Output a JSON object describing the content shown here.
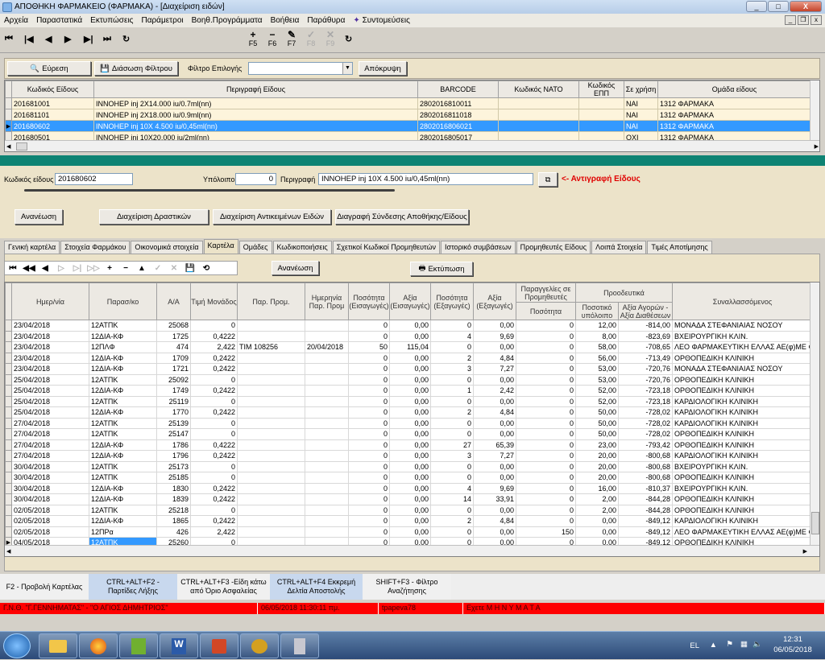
{
  "window": {
    "title": "ΑΠΟΘΗΚΗ ΦΑΡΜΑΚΕΙΟ (ΦΑΡΜΑΚΑ) - [Διαχείριση ειδών]",
    "minimize": "_",
    "maximize": "□",
    "close": "X"
  },
  "menu": [
    "Αρχεία",
    "Παραστατικά",
    "Εκτυπώσεις",
    "Παράμετροι",
    "Βοηθ.Προγράμματα",
    "Βοήθεια",
    "Παράθυρα",
    "Συντομεύσεις"
  ],
  "toolbar": {
    "nav": [
      "⏮",
      "⏭",
      "◀",
      "▶",
      "⏭",
      "▶⏭",
      "↻"
    ],
    "fkeys": [
      {
        "glyph": "+",
        "label": "F5"
      },
      {
        "glyph": "−",
        "label": "F6"
      },
      {
        "glyph": "✎",
        "label": "F7"
      },
      {
        "glyph": "✓",
        "label": "F8"
      },
      {
        "glyph": "✕",
        "label": "F9"
      }
    ],
    "refresh": "↻"
  },
  "filter": {
    "search_label": "Εύρεση",
    "save_filter_label": "Διάσωση Φίλτρου",
    "filter_choice_label": "Φίλτρο Επιλογής",
    "filter_value": "",
    "hide_label": "Απόκρυψη"
  },
  "items_grid": {
    "columns": [
      "Κωδικός Είδους",
      "Περιγραφή Είδους",
      "BARCODE",
      "Κωδικός ΝΑΤΟ",
      "Κωδικός ΕΠΠ",
      "Σε χρήση",
      "Ομάδα είδους"
    ],
    "rows": [
      {
        "code": "201681001",
        "desc": "INNOHEP inj 2X14.000 iu/0.7ml(nn)",
        "barcode": "2802016810011",
        "nato": "",
        "epp": "",
        "in_use": "ΝΑΙ",
        "group": "1312 ΦΑΡΜΑΚΑ"
      },
      {
        "code": "201681101",
        "desc": "INNOHEP inj 2X18.000 iu/0.9ml(nn)",
        "barcode": "2802016811018",
        "nato": "",
        "epp": "",
        "in_use": "ΝΑΙ",
        "group": "1312 ΦΑΡΜΑΚΑ"
      },
      {
        "code": "201680602",
        "desc": "INNOHEP inj 10X 4.500 iu/0,45ml(nn)",
        "barcode": "2802016806021",
        "nato": "",
        "epp": "",
        "in_use": "ΝΑΙ",
        "group": "1312 ΦΑΡΜΑΚΑ"
      },
      {
        "code": "201680501",
        "desc": "INNOHEP inj 10X20.000 iu/2ml(nn)",
        "barcode": "2802016805017",
        "nato": "",
        "epp": "",
        "in_use": "ΟΧΙ",
        "group": "1312 ΦΑΡΜΑΚΑ"
      }
    ],
    "selected_index": 2
  },
  "detail": {
    "code_label": "Κωδικός είδους",
    "code_value": "201680602",
    "balance_label": "Υπόλοιπο",
    "balance_value": "0",
    "desc_label": "Περιγραφή",
    "desc_value": "INNOHEP inj 10X 4.500 iu/0,45ml(nn)",
    "copy_label": "<- Αντιγραφή Είδους",
    "buttons": {
      "refresh": "Ανανέωση",
      "substances": "Διαχείριση Δραστικών",
      "equivalents": "Διαχείριση Αντικειμένων Ειδών",
      "delete_link": "Διαγραφή Σύνδεσης Αποθήκης/Είδους"
    }
  },
  "tabs": [
    "Γενική καρτέλα",
    "Στοιχεία Φαρμάκου",
    "Οικονομικά στοιχεία",
    "Καρτέλα",
    "Ομάδες",
    "Κωδικοποιήσεις",
    "Σχετικοί Κωδικοί Προμηθευτών",
    "Ιστορικό συμβάσεων",
    "Προμηθευτές Είδους",
    "Λοιπά Στοιχεία",
    "Τιμές Αποτίμησης"
  ],
  "active_tab": 3,
  "ledger": {
    "refresh_label": "Ανανέωση",
    "print_label": "Εκτύπωση",
    "nav": [
      "⏮",
      "◀◀",
      "◀",
      "▷",
      "▷|",
      "▷▷",
      "+",
      "−",
      "▲",
      "✓",
      "✕",
      "💾",
      "⟲"
    ],
    "headers": {
      "date": "Ημερ/νία",
      "doc": "Παρασ/κο",
      "aa": "Α/Α",
      "unit_price": "Τιμή Μονάδος",
      "par_prom": "Παρ. Πρoμ.",
      "date_par_prom": "Ημερηνία Παρ. Προμ",
      "qty_in": "Ποσότητα (Εισαγωγές)",
      "val_in": "Αξία (Εισαγωγές)",
      "qty_out": "Ποσότητα (Εξαγωγές)",
      "val_out": "Αξία (Εξαγωγές)",
      "orders": "Παραγγελίες σε Προμηθευτές",
      "orders_qty": "Ποσότητα",
      "progressive": "Προοδευτικά",
      "prog_qty": "Ποσοτικό υπόλοιπο",
      "prog_val": "Αξία Αγορών - Αξία Διαθέσεων",
      "party": "Συναλλασσόμενος"
    },
    "rows": [
      [
        "23/04/2018",
        "12ΑΤΠΚ",
        "25068",
        "0",
        "",
        "",
        "0",
        "0,00",
        "0",
        "0,00",
        "0",
        "12,00",
        "-814,00",
        "ΜΟΝΑΔΑ ΣΤΕΦΑΝΙΑΙΑΣ ΝΟΣΟΥ"
      ],
      [
        "23/04/2018",
        "12ΔΙΑ-ΚΦ",
        "1725",
        "0,4222",
        "",
        "",
        "0",
        "0,00",
        "4",
        "9,69",
        "0",
        "8,00",
        "-823,69",
        "ΒΧΕΙΡΟΥΡΓΙΚΗ ΚΛΙΝ."
      ],
      [
        "23/04/2018",
        "12ΠΛΦ",
        "474",
        "2,422",
        "ΤΙΜ 108256",
        "20/04/2018",
        "50",
        "115,04",
        "0",
        "0,00",
        "0",
        "58,00",
        "-708,65",
        "ΛΕΟ ΦΑΡΜΑΚΕΥΤΙΚΗ ΕΛΛΑΣ ΑΕ(φ)ΜΕ ΦΑ"
      ],
      [
        "23/04/2018",
        "12ΔΙΑ-ΚΦ",
        "1709",
        "0,2422",
        "",
        "",
        "0",
        "0,00",
        "2",
        "4,84",
        "0",
        "56,00",
        "-713,49",
        "ΟΡΘΟΠΕΔΙΚΗ ΚΛΙΝΙΚΗ"
      ],
      [
        "23/04/2018",
        "12ΔΙΑ-ΚΦ",
        "1721",
        "0,2422",
        "",
        "",
        "0",
        "0,00",
        "3",
        "7,27",
        "0",
        "53,00",
        "-720,76",
        "ΜΟΝΑΔΑ ΣΤΕΦΑΝΙΑΙΑΣ ΝΟΣΟΥ"
      ],
      [
        "25/04/2018",
        "12ΑΤΠΚ",
        "25092",
        "0",
        "",
        "",
        "0",
        "0,00",
        "0",
        "0,00",
        "0",
        "53,00",
        "-720,76",
        "ΟΡΘΟΠΕΔΙΚΗ ΚΛΙΝΙΚΗ"
      ],
      [
        "25/04/2018",
        "12ΔΙΑ-ΚΦ",
        "1749",
        "0,2422",
        "",
        "",
        "0",
        "0,00",
        "1",
        "2,42",
        "0",
        "52,00",
        "-723,18",
        "ΟΡΘΟΠΕΔΙΚΗ ΚΛΙΝΙΚΗ"
      ],
      [
        "25/04/2018",
        "12ΑΤΠΚ",
        "25119",
        "0",
        "",
        "",
        "0",
        "0,00",
        "0",
        "0,00",
        "0",
        "52,00",
        "-723,18",
        "ΚΑΡΔΙΟΛΟΓΙΚΗ ΚΛΙΝΙΚΗ"
      ],
      [
        "25/04/2018",
        "12ΔΙΑ-ΚΦ",
        "1770",
        "0,2422",
        "",
        "",
        "0",
        "0,00",
        "2",
        "4,84",
        "0",
        "50,00",
        "-728,02",
        "ΚΑΡΔΙΟΛΟΓΙΚΗ ΚΛΙΝΙΚΗ"
      ],
      [
        "27/04/2018",
        "12ΑΤΠΚ",
        "25139",
        "0",
        "",
        "",
        "0",
        "0,00",
        "0",
        "0,00",
        "0",
        "50,00",
        "-728,02",
        "ΚΑΡΔΙΟΛΟΓΙΚΗ ΚΛΙΝΙΚΗ"
      ],
      [
        "27/04/2018",
        "12ΑΤΠΚ",
        "25147",
        "0",
        "",
        "",
        "0",
        "0,00",
        "0",
        "0,00",
        "0",
        "50,00",
        "-728,02",
        "ΟΡΘΟΠΕΔΙΚΗ ΚΛΙΝΙΚΗ"
      ],
      [
        "27/04/2018",
        "12ΔΙΑ-ΚΦ",
        "1786",
        "0,4222",
        "",
        "",
        "0",
        "0,00",
        "27",
        "65,39",
        "0",
        "23,00",
        "-793,42",
        "ΟΡΘΟΠΕΔΙΚΗ ΚΛΙΝΙΚΗ"
      ],
      [
        "27/04/2018",
        "12ΔΙΑ-ΚΦ",
        "1796",
        "0,2422",
        "",
        "",
        "0",
        "0,00",
        "3",
        "7,27",
        "0",
        "20,00",
        "-800,68",
        "ΚΑΡΔΙΟΛΟΓΙΚΗ ΚΛΙΝΙΚΗ"
      ],
      [
        "30/04/2018",
        "12ΑΤΠΚ",
        "25173",
        "0",
        "",
        "",
        "0",
        "0,00",
        "0",
        "0,00",
        "0",
        "20,00",
        "-800,68",
        "ΒΧΕΙΡΟΥΡΓΙΚΗ ΚΛΙΝ."
      ],
      [
        "30/04/2018",
        "12ΑΤΠΚ",
        "25185",
        "0",
        "",
        "",
        "0",
        "0,00",
        "0",
        "0,00",
        "0",
        "20,00",
        "-800,68",
        "ΟΡΘΟΠΕΔΙΚΗ ΚΛΙΝΙΚΗ"
      ],
      [
        "30/04/2018",
        "12ΔΙΑ-ΚΦ",
        "1830",
        "0,2422",
        "",
        "",
        "0",
        "0,00",
        "4",
        "9,69",
        "0",
        "16,00",
        "-810,37",
        "ΒΧΕΙΡΟΥΡΓΙΚΗ ΚΛΙΝ."
      ],
      [
        "30/04/2018",
        "12ΔΙΑ-ΚΦ",
        "1839",
        "0,2422",
        "",
        "",
        "0",
        "0,00",
        "14",
        "33,91",
        "0",
        "2,00",
        "-844,28",
        "ΟΡΘΟΠΕΔΙΚΗ ΚΛΙΝΙΚΗ"
      ],
      [
        "02/05/2018",
        "12ΑΤΠΚ",
        "25218",
        "0",
        "",
        "",
        "0",
        "0,00",
        "0",
        "0,00",
        "0",
        "2,00",
        "-844,28",
        "ΟΡΘΟΠΕΔΙΚΗ ΚΛΙΝΙΚΗ"
      ],
      [
        "02/05/2018",
        "12ΔΙΑ-ΚΦ",
        "1865",
        "0,2422",
        "",
        "",
        "0",
        "0,00",
        "2",
        "4,84",
        "0",
        "0,00",
        "-849,12",
        "ΚΑΡΔΙΟΛΟΓΙΚΗ ΚΛΙΝΙΚΗ"
      ],
      [
        "02/05/2018",
        "12ΠΡα",
        "426",
        "2,422",
        "",
        "",
        "0",
        "0,00",
        "0",
        "0,00",
        "150",
        "0,00",
        "-849,12",
        "ΛΕΟ ΦΑΡΜΑΚΕΥΤΙΚΗ ΕΛΛΑΣ ΑΕ(φ)ΜΕ ΦΑ"
      ],
      [
        "04/05/2018",
        "12ΑΤΠΚ",
        "25260",
        "0",
        "",
        "",
        "0",
        "0,00",
        "0",
        "0,00",
        "0",
        "0,00",
        "-849,12",
        "ΟΡΘΟΠΕΔΙΚΗ ΚΛΙΝΙΚΗ"
      ]
    ]
  },
  "function_bar": [
    "F2 - Προβολή Καρτέλας",
    "CTRL+ALT+F2 - Παρτίδες Λήξης",
    "CTRL+ALT+F3 -Είδη κάτω από Όριο Ασφαλείας",
    "CTRL+ALT+F4 Εκκρεμή Δελτία Αποστολής",
    "SHIFT+F3 - Φίλτρο Αναζήτησης"
  ],
  "status": [
    "Γ.Ν.Θ. \"Γ.ΓΕΝΝΗΜΑΤΑΣ\" - \"Ο ΑΓΙΟΣ ΔΗΜΗΤΡΙΟΣ\"",
    "06/05/2018 11:30:11 πμ.",
    "tpapeva78",
    "Εχετε  Μ Η Ν Υ Μ Α Τ Α"
  ],
  "taskbar": {
    "lang": "EL",
    "time": "12:31",
    "date": "06/05/2018"
  },
  "colors": {
    "teal": "#0e8373",
    "beige": "#ece3c9",
    "selection": "#3399ff",
    "status_red": "#ff0000"
  }
}
